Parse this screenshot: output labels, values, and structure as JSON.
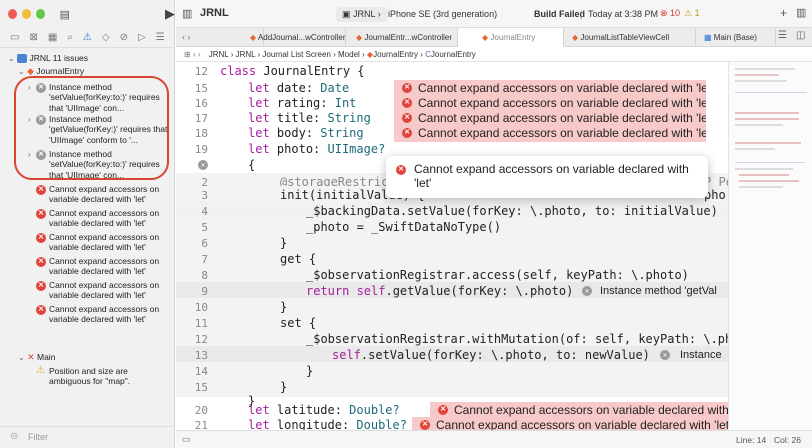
{
  "project": {
    "name": "JRNL",
    "scheme": "JRNL",
    "device": "iPhone SE (3rd generation)",
    "build_status": "Build Failed",
    "build_time": "Today at 3:38 PM",
    "errors": "10",
    "warnings": "1"
  },
  "nav": {
    "root": "JRNL 11 issues",
    "group1": "JournalEntry",
    "gray_issues": [
      "Instance method 'setValue(forKey:to:)' requires that 'UIImage' con...",
      "Instance method 'getValue(forKey:)' requires that 'UIImage' conform to '...",
      "Instance method 'setValue(forKey:to:)' requires that 'UIImage' con..."
    ],
    "error_issues": [
      "Cannot expand accessors on variable declared with 'let'",
      "Cannot expand accessors on variable declared with 'let'",
      "Cannot expand accessors on variable declared with 'let'",
      "Cannot expand accessors on variable declared with 'let'",
      "Cannot expand accessors on variable declared with 'let'",
      "Cannot expand accessors on variable declared with 'let'"
    ],
    "group2": "Main",
    "main_issue": "Position and size are ambiguous for \"map\".",
    "filter": "Filter"
  },
  "tabs": [
    "AddJournal...wController",
    "JournalEntr...wController",
    "JournalEntry",
    "JournalListTableViewCell",
    "Main (Base)"
  ],
  "breadcrumb": [
    "JRNL",
    "JRNL",
    "Journal List Screen",
    "Model",
    "JournalEntry",
    "JournalEntry"
  ],
  "code": {
    "line12": {
      "num": "12",
      "kw": "class",
      "rest": " JournalEntry {"
    },
    "line15": {
      "num": "15",
      "kw": "let",
      "name": "date",
      "type": "Date"
    },
    "line16": {
      "num": "16",
      "kw": "let",
      "name": "rating",
      "type": "Int"
    },
    "line17": {
      "num": "17",
      "kw": "let",
      "name": "title",
      "type": "String"
    },
    "line18": {
      "num": "18",
      "kw": "let",
      "name": "body",
      "type": "String"
    },
    "line19": {
      "num": "19",
      "kw": "let",
      "name": "photo",
      "type": "UIImage?"
    },
    "lineBrace": "{",
    "line2": {
      "num": "2",
      "text": "@storageRestrict"
    },
    "line3": {
      "num": "3",
      "text": "init(initialValue) {"
    },
    "line4": {
      "num": "4",
      "text": "_$backingData.setValue(forKey: \\.photo, to: initialValue)"
    },
    "line5": {
      "num": "5",
      "text": "_photo = _SwiftDataNoType()"
    },
    "line6": {
      "num": "6",
      "text": "}"
    },
    "line7": {
      "num": "7",
      "text": "get {"
    },
    "line8": {
      "num": "8",
      "text": "_$observationRegistrar.access(self, keyPath: \\.photo)"
    },
    "line9": {
      "num": "9",
      "kw": "return self",
      "text": ".getValue(forKey: \\.photo)",
      "note": "Instance method 'getVal"
    },
    "line10": {
      "num": "10",
      "text": "}"
    },
    "line11": {
      "num": "11",
      "text": "set {"
    },
    "line12b": {
      "num": "12",
      "text": "_$observationRegistrar.withMutation(of: self, keyPath: \\.pho"
    },
    "line13": {
      "num": "13",
      "kw": "self",
      "text": ".setValue(forKey: \\.photo, to: newValue)",
      "note": "Instance"
    },
    "line14": {
      "num": "14",
      "text": "}"
    },
    "line15b": {
      "num": "15",
      "text": "}"
    },
    "line16b": {
      "num": "16",
      "text": "}"
    },
    "line20": {
      "num": "20",
      "kw": "let",
      "name": "latitude",
      "type": "Double?"
    },
    "line21": {
      "num": "21",
      "kw": "let",
      "name": "longitude",
      "type": "Double?"
    },
    "pho": "pho",
    "P_pe": "P_Pe"
  },
  "error_msg": "Cannot expand accessors on variable declared with 'let'",
  "error_msg_trunc": "Cannot expand accessors on variable declared with 'l...",
  "popup": "Cannot expand accessors on variable declared with 'let'",
  "status": {
    "line": "Line: 14",
    "col": "Col: 26"
  }
}
